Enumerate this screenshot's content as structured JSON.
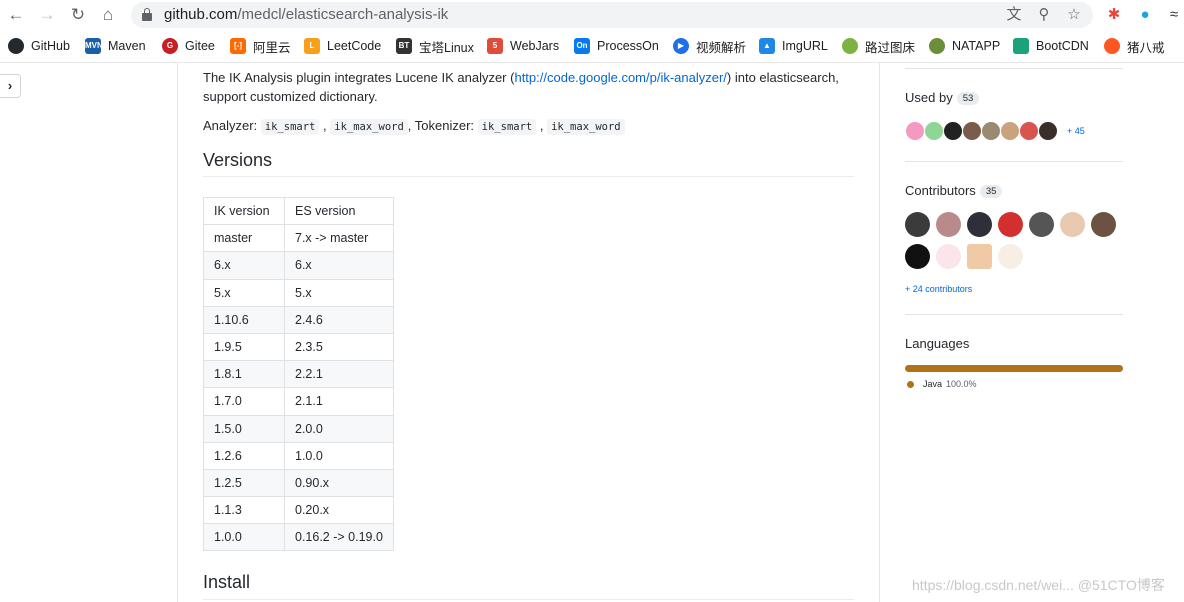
{
  "browser": {
    "url_host": "github.com",
    "url_path": "/medcl/elasticsearch-analysis-ik"
  },
  "bookmarks": [
    {
      "label": "GitHub",
      "icon": "github-icon",
      "color": "#24292e"
    },
    {
      "label": "Maven",
      "icon": "maven-icon",
      "color": "#1a5fa8"
    },
    {
      "label": "Gitee",
      "icon": "gitee-icon",
      "color": "#c71d23"
    },
    {
      "label": "阿里云",
      "icon": "aliyun-icon",
      "color": "#ff6a00"
    },
    {
      "label": "LeetCode",
      "icon": "leetcode-icon",
      "color": "#f89f1b"
    },
    {
      "label": "宝塔Linux",
      "icon": "bt-icon",
      "color": "#333333"
    },
    {
      "label": "WebJars",
      "icon": "webjars-icon",
      "color": "#e04c3c"
    },
    {
      "label": "ProcessOn",
      "icon": "processon-icon",
      "color": "#067bef"
    },
    {
      "label": "视频解析",
      "icon": "video-icon",
      "color": "#1e6fe8"
    },
    {
      "label": "ImgURL",
      "icon": "image-icon",
      "color": "#1e88e5"
    },
    {
      "label": "路过图床",
      "icon": "imgbed-icon",
      "color": "#7cb342"
    },
    {
      "label": "NATAPP",
      "icon": "natapp-icon",
      "color": "#6a8e3a"
    },
    {
      "label": "BootCDN",
      "icon": "bootcdn-icon",
      "color": "#1aa37a"
    },
    {
      "label": "猪八戒",
      "icon": "zbj-icon",
      "color": "#ff5722"
    }
  ],
  "readme": {
    "intro_before": "The IK Analysis plugin integrates Lucene IK analyzer (",
    "intro_link": "http://code.google.com/p/ik-analyzer/",
    "intro_after": ") into elasticsearch, support customized dictionary.",
    "analyzer_label": "Analyzer:",
    "analyzer_1": "ik_smart",
    "analyzer_2": "ik_max_word",
    "tokenizer_label": ", Tokenizer:",
    "tokenizer_1": "ik_smart",
    "tokenizer_2": "ik_max_word",
    "versions_heading": "Versions",
    "install_heading": "Install"
  },
  "versions_table": {
    "headers": [
      "IK version",
      "ES version"
    ],
    "rows": [
      [
        "master",
        "7.x -> master"
      ],
      [
        "6.x",
        "6.x"
      ],
      [
        "5.x",
        "5.x"
      ],
      [
        "1.10.6",
        "2.4.6"
      ],
      [
        "1.9.5",
        "2.3.5"
      ],
      [
        "1.8.1",
        "2.2.1"
      ],
      [
        "1.7.0",
        "2.1.1"
      ],
      [
        "1.5.0",
        "2.0.0"
      ],
      [
        "1.2.6",
        "1.0.0"
      ],
      [
        "1.2.5",
        "0.90.x"
      ],
      [
        "1.1.3",
        "0.20.x"
      ],
      [
        "1.0.0",
        "0.16.2 -> 0.19.0"
      ]
    ]
  },
  "sidebar": {
    "used_by_label": "Used by",
    "used_by_count": "53",
    "used_by_more": "+ 45",
    "contributors_label": "Contributors",
    "contributors_count": "35",
    "contributors_more": "+ 24 contributors",
    "languages_label": "Languages",
    "language_name": "Java",
    "language_pct": "100.0%",
    "language_color": "#b07219"
  },
  "watermark": "https://blog.csdn.net/wei... @51CTO博客"
}
